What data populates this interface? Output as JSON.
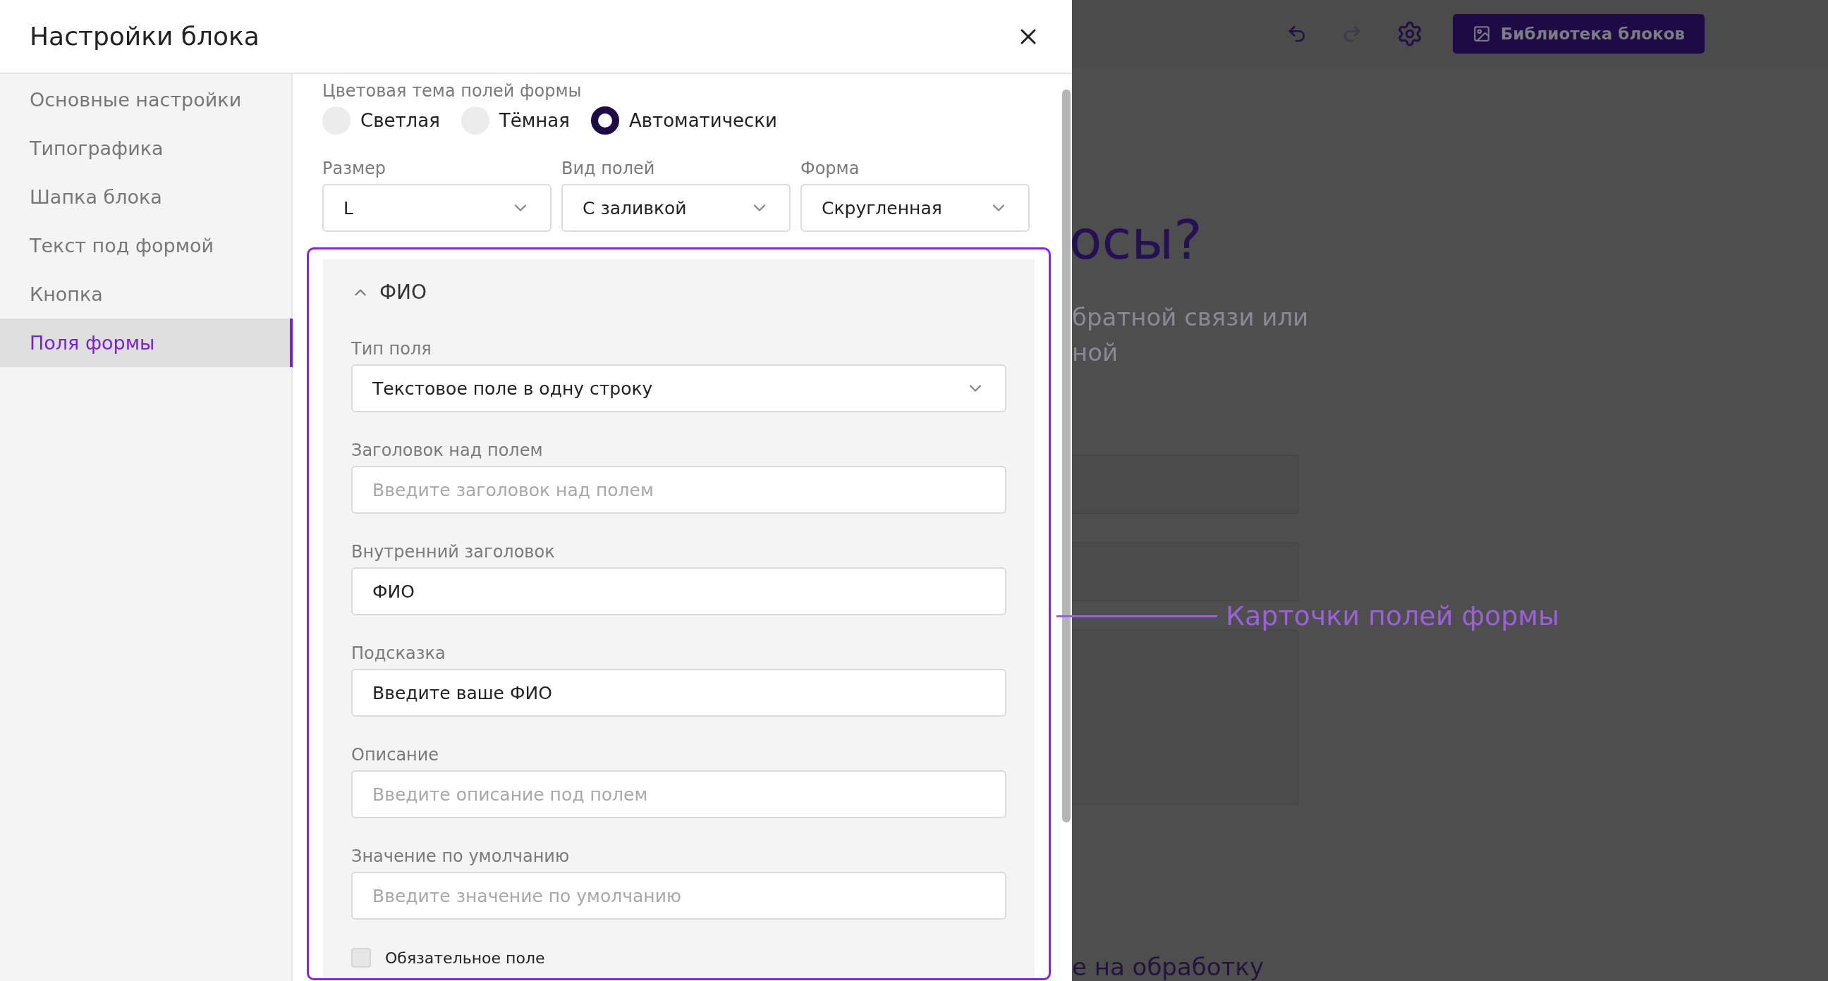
{
  "dialog": {
    "title": "Настройки блока"
  },
  "sidebar": {
    "items": [
      {
        "label": "Основные настройки",
        "selected": false
      },
      {
        "label": "Типографика",
        "selected": false
      },
      {
        "label": "Шапка блока",
        "selected": false
      },
      {
        "label": "Текст под формой",
        "selected": false
      },
      {
        "label": "Кнопка",
        "selected": false
      },
      {
        "label": "Поля формы",
        "selected": true
      }
    ]
  },
  "theme": {
    "label": "Цветовая тема полей формы",
    "options": [
      {
        "label": "Светлая",
        "selected": false
      },
      {
        "label": "Тёмная",
        "selected": false
      },
      {
        "label": "Автоматически",
        "selected": true
      }
    ]
  },
  "selects": [
    {
      "label": "Размер",
      "value": "L"
    },
    {
      "label": "Вид полей",
      "value": "С заливкой"
    },
    {
      "label": "Форма",
      "value": "Скругленная"
    }
  ],
  "field_card": {
    "title": "ФИО",
    "expanded": true,
    "fields": [
      {
        "kind": "select",
        "label": "Тип поля",
        "value": "Текстовое поле в одну строку"
      },
      {
        "kind": "input",
        "label": "Заголовок над полем",
        "placeholder": "Введите заголовок над полем"
      },
      {
        "kind": "input",
        "label": "Внутренний заголовок",
        "value": "ФИО"
      },
      {
        "kind": "input",
        "label": "Подсказка",
        "value": "Введите ваше ФИО"
      },
      {
        "kind": "input",
        "label": "Описание",
        "placeholder": "Введите описание под полем"
      },
      {
        "kind": "input",
        "label": "Значение по умолчанию",
        "placeholder": "Введите значение по умолчанию"
      }
    ],
    "required": {
      "label": "Обязательное поле",
      "checked": false
    }
  },
  "background": {
    "library_button": "Библиотека блоков",
    "heading": "осы?",
    "text_lines": [
      "братной связи или",
      "ной"
    ],
    "footer_text": "е на обработку"
  },
  "annotation": "Карточки полей формы"
}
